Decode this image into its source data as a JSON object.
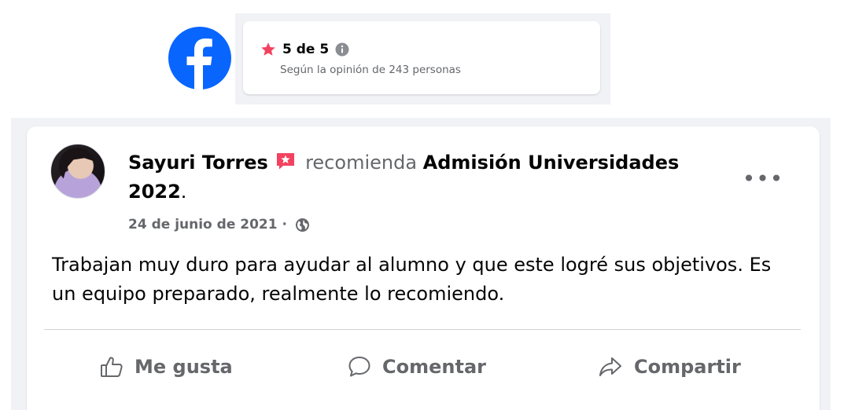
{
  "rating": {
    "value": "5 de 5",
    "subtitle": "Según la opinión de 243 personas",
    "star_color": "#f3425f"
  },
  "post": {
    "author": "Sayuri Torres",
    "verb": "recomienda",
    "page_name": "Admisión Universidades 2022",
    "trailing": ".",
    "date": "24 de junio de 2021",
    "separator": " · ",
    "audience_icon": "globe-icon",
    "more_label": "•••",
    "body": "Trabajan muy duro para ayudar al alumno y que este logré sus objetivos. Es un equipo preparado, realmente lo recomiendo.",
    "actions": {
      "like": "Me gusta",
      "comment": "Comentar",
      "share": "Compartir"
    }
  },
  "colors": {
    "brand_blue": "#0866ff",
    "secondary_text": "#65676b",
    "background": "#f0f2f5"
  }
}
